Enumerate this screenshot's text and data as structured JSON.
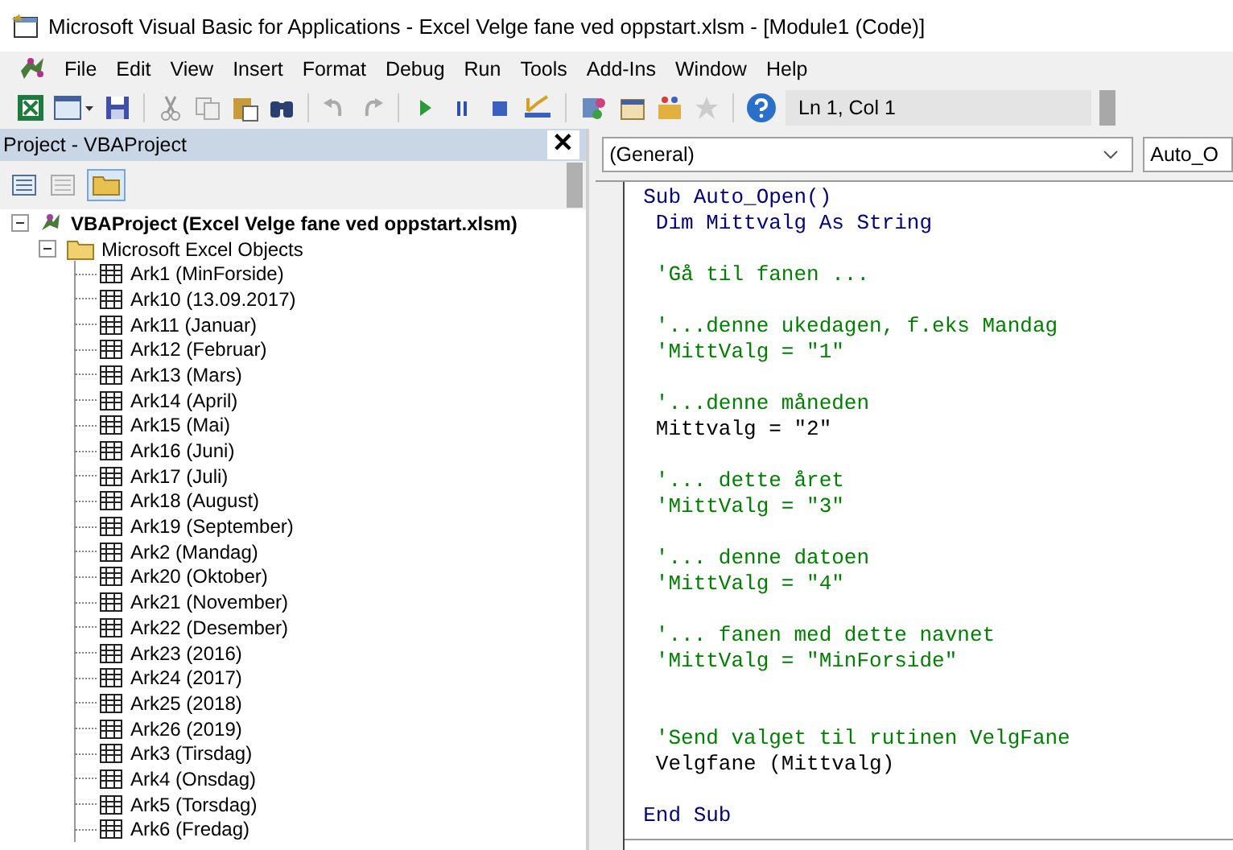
{
  "window": {
    "title": "Microsoft Visual Basic for Applications - Excel Velge fane ved oppstart.xlsm - [Module1 (Code)]"
  },
  "menu": [
    "File",
    "Edit",
    "View",
    "Insert",
    "Format",
    "Debug",
    "Run",
    "Tools",
    "Add-Ins",
    "Window",
    "Help"
  ],
  "toolbar": {
    "position": "Ln 1, Col 1"
  },
  "project_pane": {
    "title": "Project - VBAProject",
    "close": "✕",
    "tree": [
      {
        "label": "VBAProject (Excel Velge fane ved oppstart.xlsm)",
        "expanded": true,
        "children": [
          {
            "label": "Microsoft Excel Objects",
            "expanded": true,
            "children": [
              {
                "label": "Ark1 (MinForside)"
              },
              {
                "label": "Ark10 (13.09.2017)"
              },
              {
                "label": "Ark11 (Januar)"
              },
              {
                "label": "Ark12 (Februar)"
              },
              {
                "label": "Ark13 (Mars)"
              },
              {
                "label": "Ark14 (April)"
              },
              {
                "label": "Ark15 (Mai)"
              },
              {
                "label": "Ark16 (Juni)"
              },
              {
                "label": "Ark17 (Juli)"
              },
              {
                "label": "Ark18 (August)"
              },
              {
                "label": "Ark19 (September)"
              },
              {
                "label": "Ark2 (Mandag)"
              },
              {
                "label": "Ark20 (Oktober)"
              },
              {
                "label": "Ark21 (November)"
              },
              {
                "label": "Ark22 (Desember)"
              },
              {
                "label": "Ark23 (2016)"
              },
              {
                "label": "Ark24 (2017)"
              },
              {
                "label": "Ark25 (2018)"
              },
              {
                "label": "Ark26 (2019)"
              },
              {
                "label": "Ark3 (Tirsdag)"
              },
              {
                "label": "Ark4 (Onsdag)"
              },
              {
                "label": "Ark5 (Torsdag)"
              },
              {
                "label": "Ark6 (Fredag)"
              }
            ]
          }
        ]
      }
    ]
  },
  "code_pane": {
    "object_dropdown": "(General)",
    "procedure_dropdown": "Auto_O",
    "lines": [
      {
        "kind": "keyword",
        "text": "Sub Auto_Open()"
      },
      {
        "kind": "keyword",
        "text": " Dim Mittvalg As String"
      },
      {
        "kind": "blank"
      },
      {
        "kind": "comment",
        "text": " 'Gå til fanen ..."
      },
      {
        "kind": "blank"
      },
      {
        "kind": "comment",
        "text": " '...denne ukedagen, f.eks Mandag"
      },
      {
        "kind": "comment",
        "text": " 'MittValg = \"1\""
      },
      {
        "kind": "blank"
      },
      {
        "kind": "comment",
        "text": " '...denne måneden"
      },
      {
        "kind": "code",
        "text": " Mittvalg = \"2\""
      },
      {
        "kind": "blank"
      },
      {
        "kind": "comment",
        "text": " '... dette året"
      },
      {
        "kind": "comment",
        "text": " 'MittValg = \"3\""
      },
      {
        "kind": "blank"
      },
      {
        "kind": "comment",
        "text": " '... denne datoen"
      },
      {
        "kind": "comment",
        "text": " 'MittValg = \"4\""
      },
      {
        "kind": "blank"
      },
      {
        "kind": "comment",
        "text": " '... fanen med dette navnet"
      },
      {
        "kind": "comment",
        "text": " 'MittValg = \"MinForside\""
      },
      {
        "kind": "blank"
      },
      {
        "kind": "blank"
      },
      {
        "kind": "comment",
        "text": " 'Send valget til rutinen VelgFane"
      },
      {
        "kind": "code",
        "text": " Velgfane (Mittvalg)"
      },
      {
        "kind": "blank"
      },
      {
        "kind": "keyword",
        "text": "End Sub"
      }
    ]
  }
}
